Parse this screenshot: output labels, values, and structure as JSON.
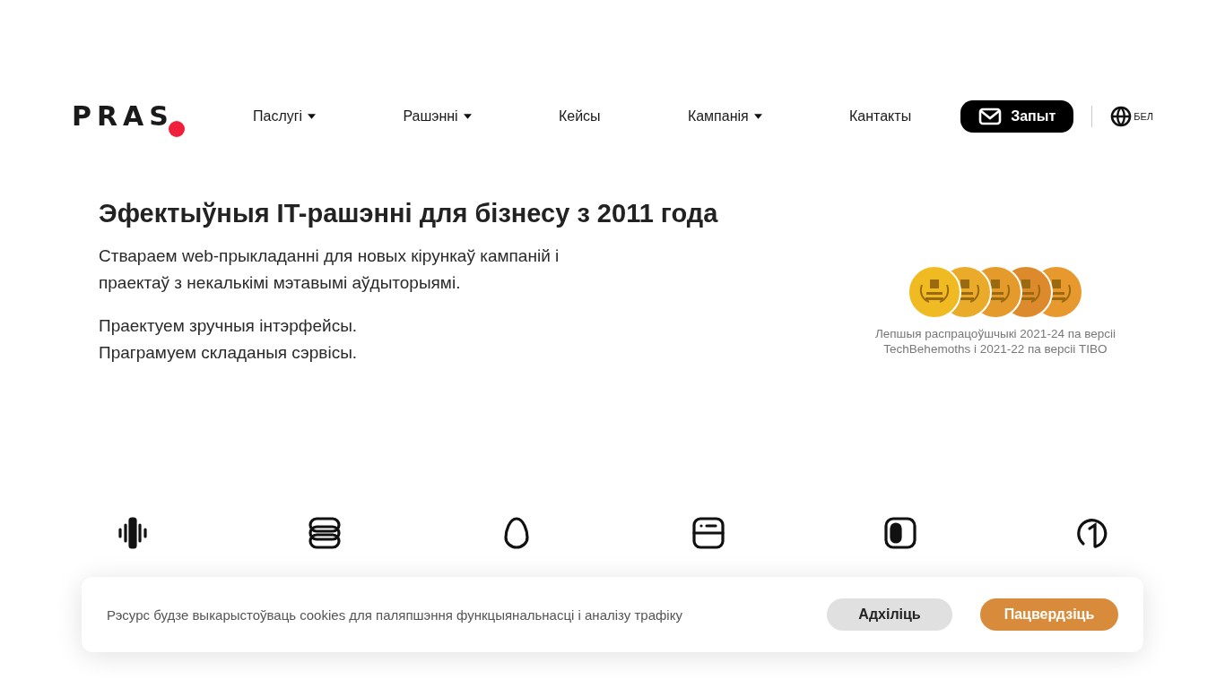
{
  "header": {
    "logo": "PRAS",
    "nav": [
      {
        "label": "Паслугі",
        "dropdown": true
      },
      {
        "label": "Рашэнні",
        "dropdown": true
      },
      {
        "label": "Кейсы",
        "dropdown": false
      },
      {
        "label": "Кампанія",
        "dropdown": true
      },
      {
        "label": "Кантакты",
        "dropdown": false
      }
    ],
    "request_button": "Запыт",
    "language": "БЕЛ"
  },
  "hero": {
    "title": "Эфектыўныя IT-рашэнні для бізнесу з 2011 года",
    "paragraphs": [
      "Ствараем web-прыкладанні для новых кірункаў кампаній і праектаў з некалькімі мэтавымі аўдыторыямі.",
      "Праектуем зручныя інтэрфейсы.\nПраграмуем складаныя сэрвісы."
    ],
    "awards": {
      "medals": [
        {
          "color": "#f0bb22"
        },
        {
          "color": "#ebab2a"
        },
        {
          "color": "#e59a2c"
        },
        {
          "color": "#dc8a2c"
        },
        {
          "color": "#e7992e"
        }
      ],
      "caption": "Лепшыя распрацоўшчыкі 2021-24 па версіі\nTechBehemoths і 2021-22 па версіі TIBO"
    }
  },
  "features": [
    {
      "kind": "bars"
    },
    {
      "kind": "stack"
    },
    {
      "kind": "egg"
    },
    {
      "kind": "window"
    },
    {
      "kind": "toggle"
    },
    {
      "kind": "one"
    }
  ],
  "cookie": {
    "text": "Рэсурс будзе выкарыстоўваць cookies для паляпшэння функцыянальнасці і аналізу трафіку",
    "decline": "Адхіліць",
    "accept": "Пацвердзіць"
  }
}
